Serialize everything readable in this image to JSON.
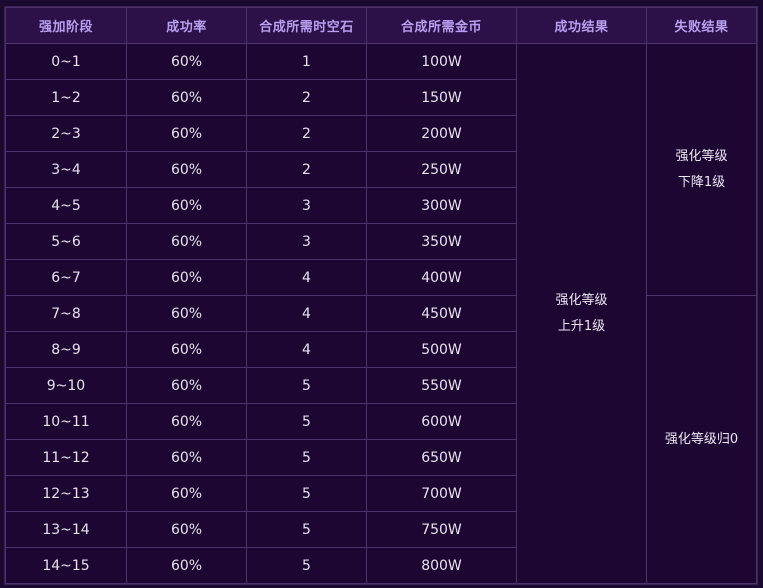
{
  "headers": [
    "强加阶段",
    "成功率",
    "合成所需时空石",
    "合成所需金币",
    "成功结果",
    "失败结果"
  ],
  "rows": [
    {
      "stage": "0~1",
      "rate": "60%",
      "stones": "1",
      "gold": "100W"
    },
    {
      "stage": "1~2",
      "rate": "60%",
      "stones": "2",
      "gold": "150W"
    },
    {
      "stage": "2~3",
      "rate": "60%",
      "stones": "2",
      "gold": "200W"
    },
    {
      "stage": "3~4",
      "rate": "60%",
      "stones": "2",
      "gold": "250W"
    },
    {
      "stage": "4~5",
      "rate": "60%",
      "stones": "3",
      "gold": "300W"
    },
    {
      "stage": "5~6",
      "rate": "60%",
      "stones": "3",
      "gold": "350W"
    },
    {
      "stage": "6~7",
      "rate": "60%",
      "stones": "4",
      "gold": "400W"
    },
    {
      "stage": "7~8",
      "rate": "60%",
      "stones": "4",
      "gold": "450W"
    },
    {
      "stage": "8~9",
      "rate": "60%",
      "stones": "4",
      "gold": "500W"
    },
    {
      "stage": "9~10",
      "rate": "60%",
      "stones": "5",
      "gold": "550W"
    },
    {
      "stage": "10~11",
      "rate": "60%",
      "stones": "5",
      "gold": "600W"
    },
    {
      "stage": "11~12",
      "rate": "60%",
      "stones": "5",
      "gold": "650W"
    },
    {
      "stage": "12~13",
      "rate": "60%",
      "stones": "5",
      "gold": "700W"
    },
    {
      "stage": "13~14",
      "rate": "60%",
      "stones": "5",
      "gold": "750W"
    },
    {
      "stage": "14~15",
      "rate": "60%",
      "stones": "5",
      "gold": "800W"
    }
  ],
  "success_result": {
    "line1": "强化等级",
    "line2": "上升1级"
  },
  "fail_result_low": {
    "line1": "强化等级",
    "line2": "下降1级"
  },
  "fail_result_high": {
    "text": "强化等级归0"
  },
  "colors": {
    "background": "#1e0633",
    "header_bg": "#2b1148",
    "header_text": "#b99ff0",
    "border": "#4a3368",
    "cell_text": "#e7e2ee"
  }
}
